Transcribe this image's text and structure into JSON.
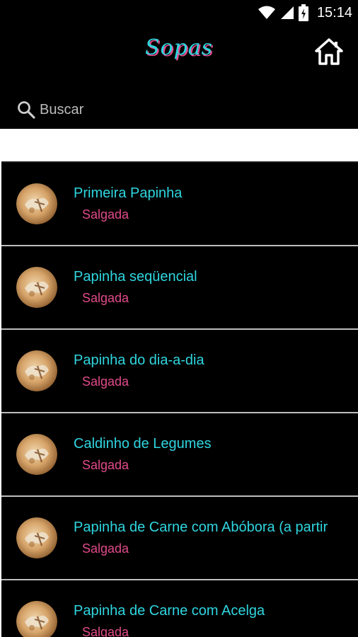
{
  "status_bar": {
    "time": "15:14",
    "icons": [
      "wifi-icon",
      "signal-icon",
      "battery-charging-icon"
    ]
  },
  "app_bar": {
    "title": "Sopas",
    "home_icon": "home-icon"
  },
  "search": {
    "placeholder": "Buscar",
    "value": ""
  },
  "recipes": [
    {
      "title": "Primeira Papinha",
      "category": "Salgada"
    },
    {
      "title": "Papinha seqüencial",
      "category": "Salgada"
    },
    {
      "title": "Papinha do dia-a-dia",
      "category": "Salgada"
    },
    {
      "title": "Caldinho de Legumes",
      "category": "Salgada"
    },
    {
      "title": "Papinha de Carne com Abóbora (a partir",
      "category": "Salgada"
    },
    {
      "title": "Papinha de Carne com Acelga",
      "category": "Salgada"
    }
  ],
  "colors": {
    "title": "#2fd6e0",
    "category": "#e24b8a",
    "background": "#000000"
  }
}
